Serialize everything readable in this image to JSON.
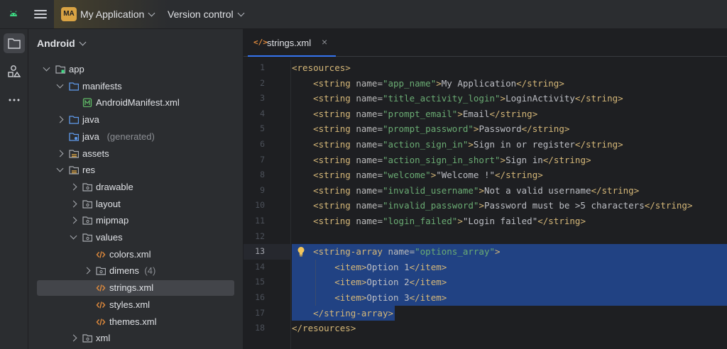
{
  "topbar": {
    "project_initials": "MA",
    "project_name": "My Application",
    "vcs_label": "Version control"
  },
  "colors": {
    "accent": "#3574f0",
    "selection": "#214283",
    "badge": "#d9a343"
  },
  "panel": {
    "title": "Android",
    "tree": [
      {
        "label": "app",
        "icon": "module-folder-icon",
        "expanded": true
      },
      {
        "label": "manifests",
        "icon": "folder-icon",
        "expanded": true
      },
      {
        "label": "AndroidManifest.xml",
        "icon": "manifest-file-icon"
      },
      {
        "label": "java",
        "icon": "folder-icon",
        "expanded": false
      },
      {
        "label": "java",
        "suffix": "(generated)",
        "icon": "generated-folder-icon"
      },
      {
        "label": "assets",
        "icon": "resource-folder-icon",
        "expanded": false
      },
      {
        "label": "res",
        "icon": "resource-folder-icon",
        "expanded": true
      },
      {
        "label": "drawable",
        "icon": "package-folder-icon",
        "expanded": false
      },
      {
        "label": "layout",
        "icon": "package-folder-icon",
        "expanded": false
      },
      {
        "label": "mipmap",
        "icon": "package-folder-icon",
        "expanded": false
      },
      {
        "label": "values",
        "icon": "package-folder-icon",
        "expanded": true
      },
      {
        "label": "colors.xml",
        "icon": "xml-file-icon"
      },
      {
        "label": "dimens",
        "suffix": "(4)",
        "icon": "package-folder-icon",
        "expanded": false
      },
      {
        "label": "strings.xml",
        "icon": "xml-file-icon",
        "selected": true
      },
      {
        "label": "styles.xml",
        "icon": "xml-file-icon"
      },
      {
        "label": "themes.xml",
        "icon": "xml-file-icon"
      },
      {
        "label": "xml",
        "icon": "package-folder-icon",
        "expanded": false
      }
    ]
  },
  "editor": {
    "tab_label": "strings.xml",
    "tab_close": "×",
    "current_line": 13,
    "lines": [
      "<resources>",
      "    <string name=\"app_name\">My Application</string>",
      "    <string name=\"title_activity_login\">LoginActivity</string>",
      "    <string name=\"prompt_email\">Email</string>",
      "    <string name=\"prompt_password\">Password</string>",
      "    <string name=\"action_sign_in\">Sign in or register</string>",
      "    <string name=\"action_sign_in_short\">Sign in</string>",
      "    <string name=\"welcome\">\"Welcome !\"</string>",
      "    <string name=\"invalid_username\">Not a valid username</string>",
      "    <string name=\"invalid_password\">Password must be >5 characters</string>",
      "    <string name=\"login_failed\">\"Login failed\"</string>",
      "",
      "    <string-array name=\"options_array\">",
      "        <item>Option 1</item>",
      "        <item>Option 2</item>",
      "        <item>Option 3</item>",
      "    </string-array>",
      "</resources>"
    ],
    "line_numbers": [
      "1",
      "2",
      "3",
      "4",
      "5",
      "6",
      "7",
      "8",
      "9",
      "10",
      "11",
      "12",
      "13",
      "14",
      "15",
      "16",
      "17",
      "18"
    ]
  }
}
